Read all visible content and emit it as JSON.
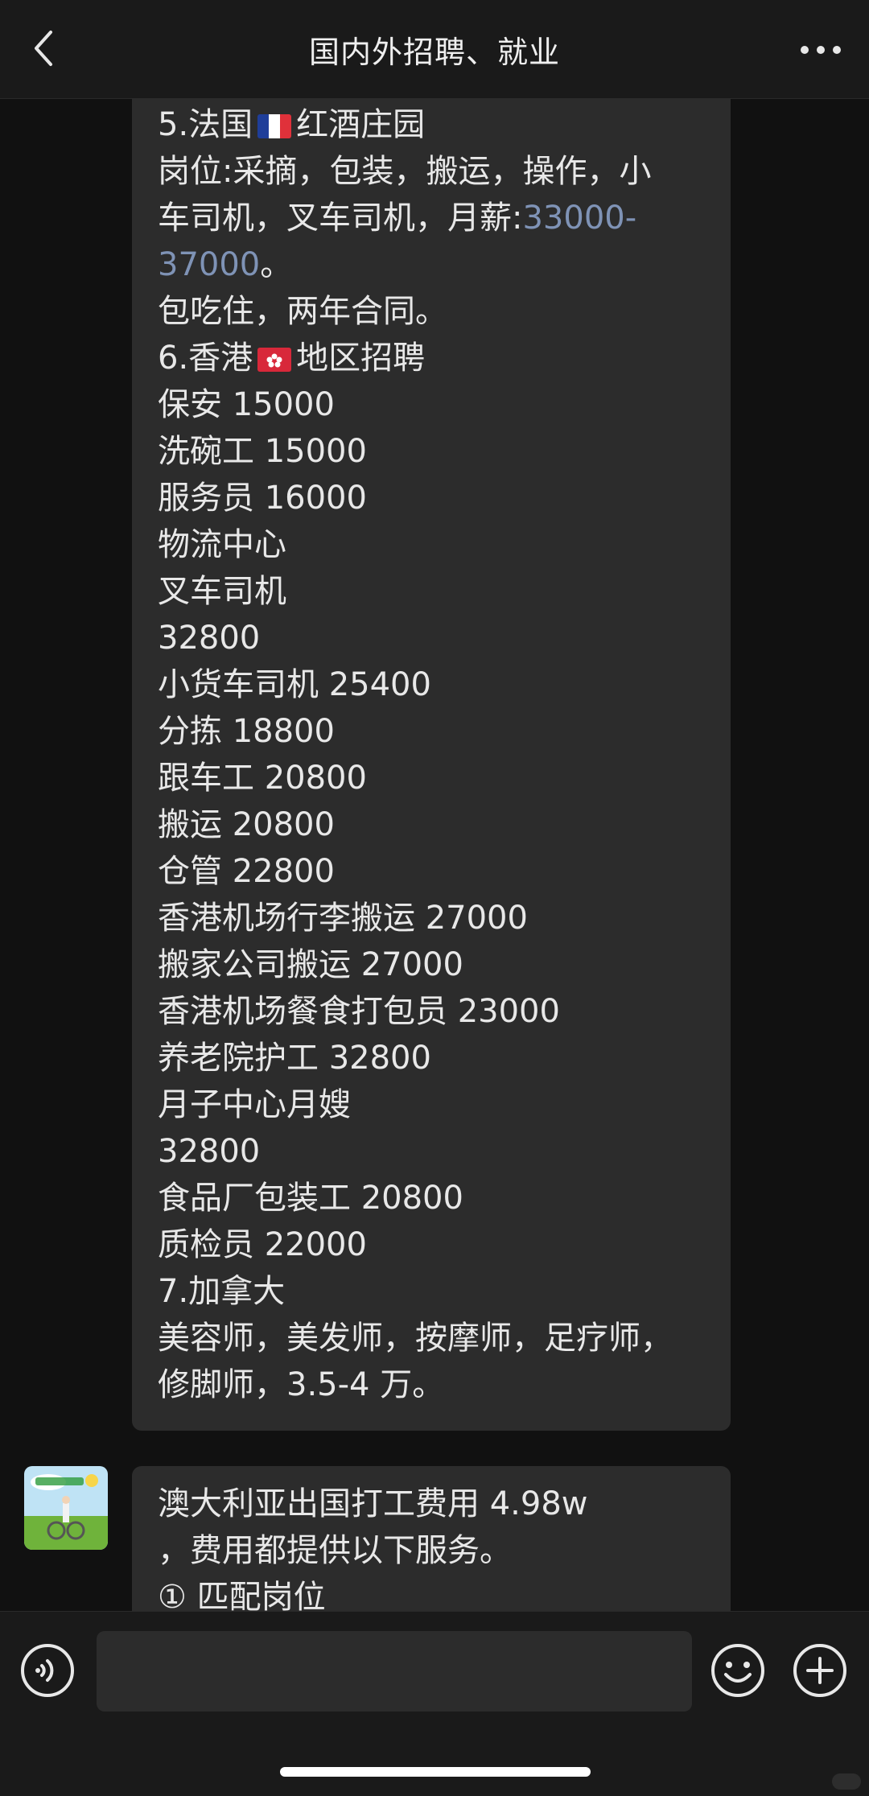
{
  "header": {
    "title": "国内外招聘、就业"
  },
  "icons": {
    "back": "chevron-left-icon",
    "more": "more-horizontal-icon",
    "voice": "voice-icon",
    "emoji": "emoji-icon",
    "plus": "plus-icon"
  },
  "message1": {
    "lines": [
      {
        "type": "flag-fr",
        "pre": "5.法国",
        "post": "红酒庄园"
      },
      {
        "text": "岗位:采摘，包装，搬运，操作，小"
      },
      {
        "text": "车司机，叉车司机，月薪:",
        "link": "33000-"
      },
      {
        "link": "37000",
        "post": "。"
      },
      {
        "text": "包吃住，两年合同。"
      },
      {
        "type": "flag-hk",
        "pre": "6.香港",
        "post": "地区招聘"
      },
      {
        "text": "保安 15000"
      },
      {
        "text": "洗碗工 15000"
      },
      {
        "text": "服务员 16000"
      },
      {
        "text": "物流中心"
      },
      {
        "text": "叉车司机"
      },
      {
        "text": "32800"
      },
      {
        "text": "小货车司机 25400"
      },
      {
        "text": "分拣 18800"
      },
      {
        "text": "跟车工 20800"
      },
      {
        "text": "搬运 20800"
      },
      {
        "text": "仓管 22800"
      },
      {
        "text": "香港机场行李搬运 27000"
      },
      {
        "text": "搬家公司搬运 27000"
      },
      {
        "text": "香港机场餐食打包员 23000"
      },
      {
        "text": "养老院护工 32800"
      },
      {
        "text": "月子中心月嫂"
      },
      {
        "text": "32800"
      },
      {
        "text": "食品厂包装工 20800"
      },
      {
        "text": "质检员 22000"
      },
      {
        "text": "7.加拿大"
      },
      {
        "text": "美容师，美发师，按摩师，足疗师，"
      },
      {
        "text": "修脚师，3.5-4 万。"
      }
    ]
  },
  "message2": {
    "lines": [
      {
        "text": "澳大利亚出国打工费用 4.98w"
      },
      {
        "text": "，费用都提供以下服务。"
      },
      {
        "text": "① 匹配岗位"
      }
    ]
  },
  "input": {
    "value": "",
    "placeholder": ""
  },
  "colors": {
    "link": "#7f93b6",
    "bubble": "#2c2c2c",
    "background": "#111111"
  }
}
